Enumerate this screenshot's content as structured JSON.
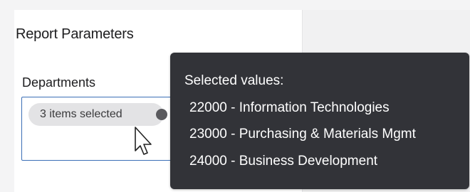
{
  "panel": {
    "title": "Report Parameters",
    "departments_label": "Departments",
    "chip_label": "3 items selected"
  },
  "tooltip": {
    "title": "Selected values:",
    "items": [
      "22000 - Information Technologies",
      "23000 - Purchasing & Materials Mgmt",
      "24000 - Business Development"
    ]
  },
  "icons": {
    "chip_remove": "close-circle-icon",
    "cursor": "mouse-pointer-icon"
  },
  "colors": {
    "tooltip_bg": "#323338",
    "field_border": "#3b6fb6",
    "chip_bg": "#e3e3e5"
  }
}
